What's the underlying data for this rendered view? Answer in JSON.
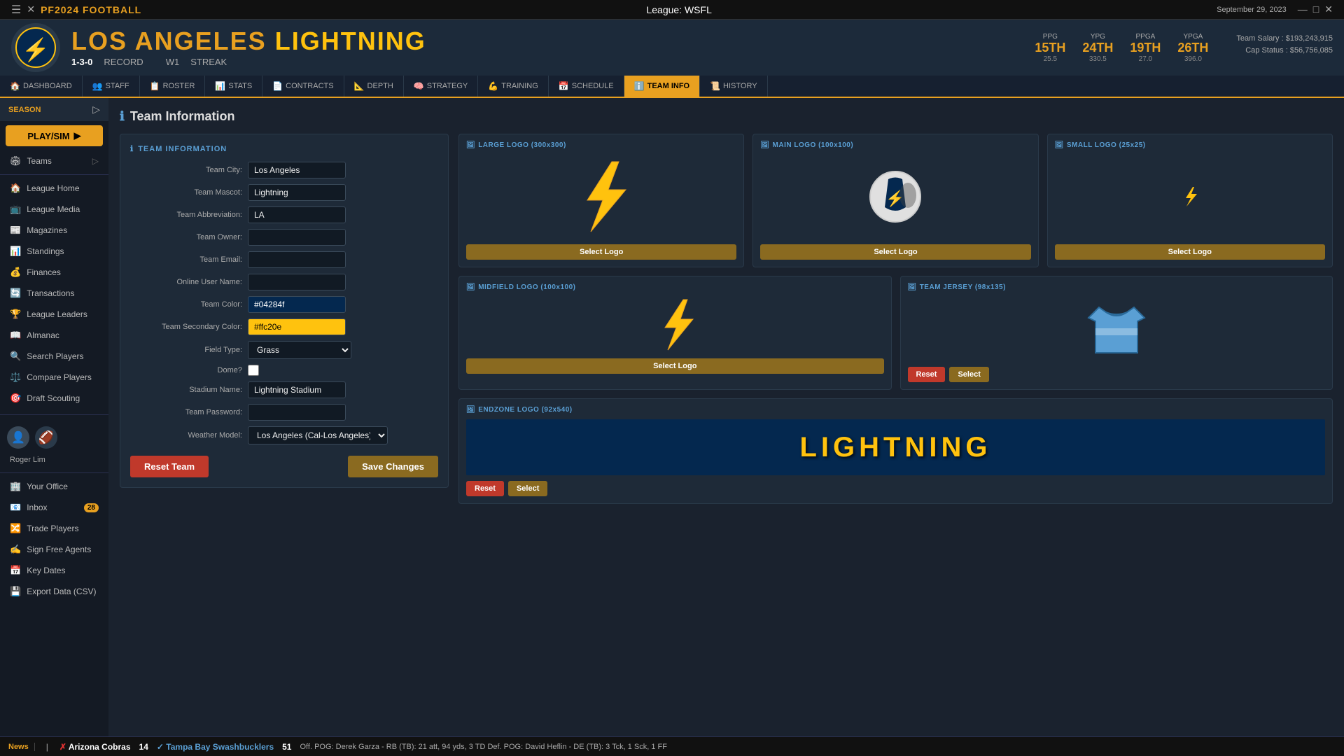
{
  "topbar": {
    "logo": "PF2024 FOOTBALL",
    "league": "League: WSFL",
    "date": "September 29, 2023"
  },
  "header": {
    "team_city": "LOS ANGELES",
    "team_name": "LIGHTNING",
    "record": "1-3-0",
    "record_label": "RECORD",
    "streak": "W1",
    "streak_label": "STREAK",
    "stats": [
      {
        "label": "PPG",
        "rank": "15TH",
        "val": "25.5"
      },
      {
        "label": "YPG",
        "rank": "24TH",
        "val": "330.5"
      },
      {
        "label": "PPGA",
        "rank": "19TH",
        "val": "27.0"
      },
      {
        "label": "YPGA",
        "rank": "26TH",
        "val": "396.0"
      }
    ],
    "team_salary": "Team Salary : $193,243,915",
    "cap_status": "Cap Status : $56,756,085"
  },
  "navtabs": [
    {
      "id": "dashboard",
      "label": "DASHBOARD",
      "icon": "🏠"
    },
    {
      "id": "staff",
      "label": "STAFF",
      "icon": "👥"
    },
    {
      "id": "roster",
      "label": "ROSTER",
      "icon": "📋"
    },
    {
      "id": "stats",
      "label": "STATS",
      "icon": "📊"
    },
    {
      "id": "contracts",
      "label": "CONTRACTS",
      "icon": "📄"
    },
    {
      "id": "depth",
      "label": "DEPTH",
      "icon": "📐"
    },
    {
      "id": "strategy",
      "label": "STRATEGY",
      "icon": "🧠"
    },
    {
      "id": "training",
      "label": "TRAINING",
      "icon": "💪"
    },
    {
      "id": "schedule",
      "label": "SCHEDULE",
      "icon": "📅"
    },
    {
      "id": "team-info",
      "label": "TEAM INFO",
      "icon": "ℹ️",
      "active": true
    },
    {
      "id": "history",
      "label": "HISTORY",
      "icon": "📜"
    }
  ],
  "sidebar": {
    "season_label": "SEASON",
    "play_sim": "PLAY/SIM",
    "items": [
      {
        "id": "teams",
        "label": "Teams",
        "icon": "🏟"
      },
      {
        "id": "league-home",
        "label": "League Home",
        "icon": "🏠"
      },
      {
        "id": "league-media",
        "label": "League Media",
        "icon": "📺"
      },
      {
        "id": "magazines",
        "label": "Magazines",
        "icon": "📰"
      },
      {
        "id": "standings",
        "label": "Standings",
        "icon": "📊"
      },
      {
        "id": "finances",
        "label": "Finances",
        "icon": "💰"
      },
      {
        "id": "transactions",
        "label": "Transactions",
        "icon": "🔄"
      },
      {
        "id": "league-leaders",
        "label": "League Leaders",
        "icon": "🏆"
      },
      {
        "id": "almanac",
        "label": "Almanac",
        "icon": "📖"
      },
      {
        "id": "search-players",
        "label": "Search Players",
        "icon": "🔍"
      },
      {
        "id": "compare-players",
        "label": "Compare Players",
        "icon": "⚖️"
      },
      {
        "id": "draft-scouting",
        "label": "Draft Scouting",
        "icon": "🎯"
      }
    ],
    "user_name": "Roger Lim",
    "bottom_items": [
      {
        "id": "your-office",
        "label": "Your Office",
        "icon": "🏢"
      },
      {
        "id": "inbox",
        "label": "Inbox",
        "icon": "📧",
        "badge": "28"
      },
      {
        "id": "trade-players",
        "label": "Trade Players",
        "icon": "🔀"
      },
      {
        "id": "sign-free-agents",
        "label": "Sign Free Agents",
        "icon": "✍️"
      },
      {
        "id": "key-dates",
        "label": "Key Dates",
        "icon": "📅"
      },
      {
        "id": "export-data",
        "label": "Export Data (CSV)",
        "icon": "💾"
      }
    ]
  },
  "page": {
    "title": "Team Information"
  },
  "form": {
    "title": "TEAM INFORMATION",
    "fields": {
      "team_city_label": "Team City:",
      "team_city_val": "Los Angeles",
      "team_mascot_label": "Team Mascot:",
      "team_mascot_val": "Lightning",
      "team_abbrev_label": "Team Abbreviation:",
      "team_abbrev_val": "LA",
      "team_owner_label": "Team Owner:",
      "team_owner_val": "",
      "team_email_label": "Team Email:",
      "team_email_val": "",
      "online_username_label": "Online User Name:",
      "online_username_val": "",
      "team_color_label": "Team Color:",
      "team_color_val": "#04284f",
      "team_secondary_label": "Team Secondary Color:",
      "team_secondary_val": "#ffc20e",
      "field_type_label": "Field Type:",
      "field_type_val": "Grass",
      "dome_label": "Dome?",
      "stadium_name_label": "Stadium Name:",
      "stadium_name_val": "Lightning Stadium",
      "team_password_label": "Team Password:",
      "team_password_val": "",
      "weather_model_label": "Weather Model:",
      "weather_model_val": "Los Angeles (Cal-Los Angeles)"
    },
    "reset_team_label": "Reset Team",
    "save_changes_label": "Save Changes"
  },
  "logos": {
    "large_logo_title": "LARGE LOGO (300x300)",
    "main_logo_title": "MAIN LOGO (100x100)",
    "small_logo_title": "SMALL LOGO (25x25)",
    "midfield_logo_title": "MIDFIELD LOGO (100x100)",
    "team_jersey_title": "TEAM JERSEY (98x135)",
    "endzone_logo_title": "ENDZONE LOGO (92x540)",
    "select_logo_label": "Select Logo",
    "reset_label": "Reset",
    "select_label": "Select",
    "endzone_text": "LIGHTNING"
  },
  "bottombar": {
    "news_label": "News",
    "score1_team1": "Arizona Cobras",
    "score1_val1": "14",
    "score1_team2": "Tampa Bay Swashbucklers",
    "score1_val2": "51",
    "details": "Off. POG: Derek Garza - RB (TB): 21 att, 94 yds, 3 TD   Def. POG: David Heflin - DE (TB): 3 Tck, 1 Sck, 1 FF"
  }
}
